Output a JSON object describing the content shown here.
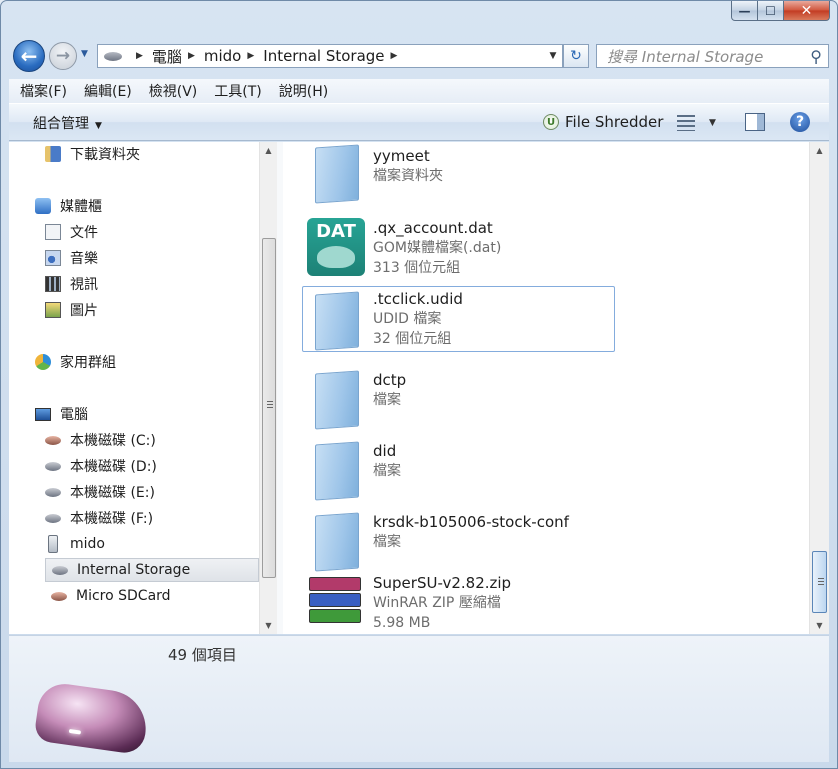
{
  "window": {
    "caption_min": "—",
    "caption_max": "☐",
    "caption_close": "✕"
  },
  "nav": {
    "back_glyph": "←",
    "forward_glyph": "→",
    "breadcrumb": [
      "電腦",
      "mido",
      "Internal Storage"
    ],
    "search_placeholder": "搜尋 Internal Storage",
    "refresh_glyph": "↻",
    "search_glyph": "⚲"
  },
  "menubar": [
    "檔案(F)",
    "編輯(E)",
    "檢視(V)",
    "工具(T)",
    "說明(H)"
  ],
  "commandbar": {
    "organize": "組合管理",
    "file_shredder": "File Shredder",
    "help": "?"
  },
  "navpane": {
    "items": [
      {
        "label": "下載資料夾",
        "icon": "downloads-folder-icon"
      },
      {
        "label": "媒體櫃",
        "icon": "libraries-icon"
      },
      {
        "label": "文件",
        "icon": "documents-icon"
      },
      {
        "label": "音樂",
        "icon": "music-icon"
      },
      {
        "label": "視訊",
        "icon": "videos-icon"
      },
      {
        "label": "圖片",
        "icon": "pictures-icon"
      },
      {
        "label": "家用群組",
        "icon": "homegroup-icon"
      },
      {
        "label": "電腦",
        "icon": "computer-icon"
      },
      {
        "label": "本機磁碟 (C:)",
        "icon": "drive-c-icon"
      },
      {
        "label": "本機磁碟 (D:)",
        "icon": "drive-icon"
      },
      {
        "label": "本機磁碟 (E:)",
        "icon": "drive-icon"
      },
      {
        "label": "本機磁碟 (F:)",
        "icon": "drive-icon"
      },
      {
        "label": "mido",
        "icon": "phone-device-icon"
      },
      {
        "label": "Internal Storage",
        "icon": "storage-icon",
        "selected": true
      },
      {
        "label": "Micro SDCard",
        "icon": "storage-icon"
      }
    ]
  },
  "files": [
    {
      "name": "yymeet",
      "type": "檔案資料夾",
      "size": "",
      "icon": "folder-icon"
    },
    {
      "name": ".qx_account.dat",
      "type": "GOM媒體檔案(.dat)",
      "size": "313 個位元組",
      "icon": "dat-file-icon",
      "icon_text": "DAT"
    },
    {
      "name": ".tcclick.udid",
      "type": "UDID 檔案",
      "size": "32 個位元組",
      "icon": "blank-file-icon",
      "selected": true
    },
    {
      "name": "dctp",
      "type": "檔案",
      "size": "",
      "icon": "blank-file-icon"
    },
    {
      "name": "did",
      "type": "檔案",
      "size": "",
      "icon": "blank-file-icon"
    },
    {
      "name": "krsdk-b105006-stock-conf",
      "type": "檔案",
      "size": "",
      "icon": "blank-file-icon"
    },
    {
      "name": "SuperSU-v2.82.zip",
      "type": "WinRAR ZIP 壓縮檔",
      "size": "5.98 MB",
      "icon": "winrar-zip-icon"
    }
  ],
  "details": {
    "item_count": "49 個項目"
  },
  "colors": {
    "accent": "#2a6cc0",
    "selection_border": "#84acdd",
    "dat_green": "#1d8176"
  }
}
